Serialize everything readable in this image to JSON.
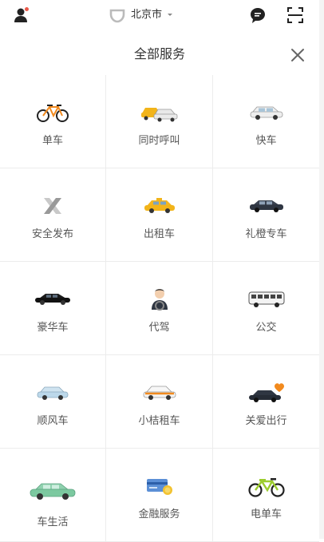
{
  "topbar": {
    "city": "北京市",
    "icons": [
      "user-icon",
      "didi-logo-icon",
      "message-icon",
      "scan-icon"
    ]
  },
  "header": {
    "title": "全部服务",
    "close_icon": "close-icon"
  },
  "services": [
    {
      "label": "单车",
      "icon": "bicycle-icon"
    },
    {
      "label": "同时呼叫",
      "icon": "multi-car-icon"
    },
    {
      "label": "快车",
      "icon": "express-car-icon"
    },
    {
      "label": "安全发布",
      "icon": "safety-x-icon"
    },
    {
      "label": "出租车",
      "icon": "taxi-icon"
    },
    {
      "label": "礼橙专车",
      "icon": "premium-car-icon"
    },
    {
      "label": "豪华车",
      "icon": "luxury-car-icon"
    },
    {
      "label": "代驾",
      "icon": "chauffeur-icon"
    },
    {
      "label": "公交",
      "icon": "bus-icon"
    },
    {
      "label": "顺风车",
      "icon": "hitch-car-icon"
    },
    {
      "label": "小桔租车",
      "icon": "rental-car-icon"
    },
    {
      "label": "关爱出行",
      "icon": "care-car-icon"
    },
    {
      "label": "车生活",
      "icon": "car-life-icon"
    },
    {
      "label": "金融服务",
      "icon": "finance-card-icon"
    },
    {
      "label": "电单车",
      "icon": "ebike-icon"
    }
  ],
  "colors": {
    "accent_orange": "#f28a1e",
    "notify_red": "#ea5a4a",
    "divider": "#ececec"
  }
}
